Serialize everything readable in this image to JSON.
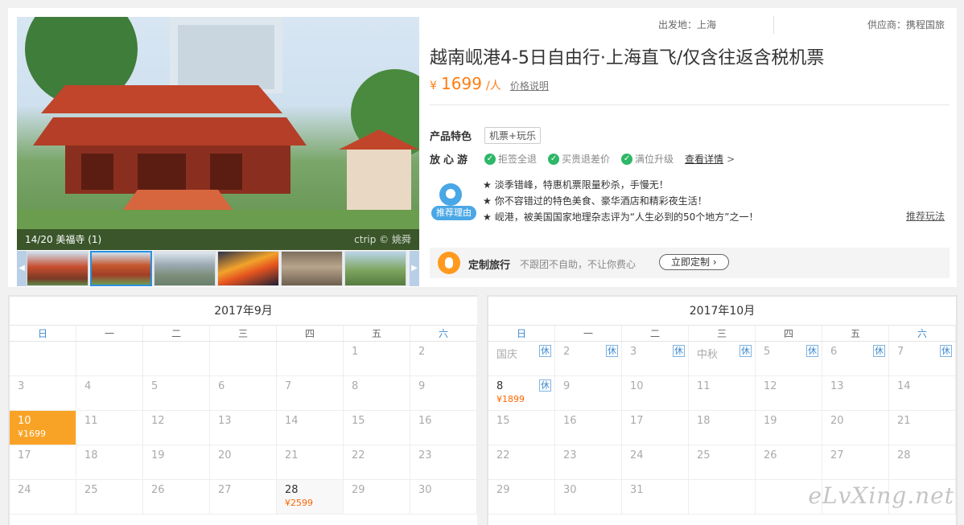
{
  "gallery": {
    "caption": "14/20 美福寺 (1)",
    "watermark": "ctrip © 姚舜",
    "prev": "◀",
    "next": "▶",
    "thumb_count": 6,
    "active_thumb": 2
  },
  "product": {
    "departure": "出发地：上海",
    "supplier": "供应商：携程国旅",
    "title": "越南岘港4-5日自由行·上海直飞/仅含往返含税机票",
    "price_symbol": "¥",
    "price": "1699",
    "price_unit": "/人",
    "price_note": "价格说明",
    "feature_label": "产品特色",
    "feature_tag": "机票+玩乐",
    "assure_label": "放心游",
    "assure_items": [
      "拒签全退",
      "买贵退差价",
      "满位升级"
    ],
    "assure_more": "查看详情",
    "assure_chevron": ">",
    "recommend_badge": "推荐理由",
    "recommend_lines": [
      "淡季错峰，特惠机票限量秒杀，手慢无！",
      "你不容错过的特色美食、豪华酒店和精彩夜生活！",
      "岘港，被美国国家地理杂志评为“人生必到的50个地方”之一！"
    ],
    "recommend_link": "推荐玩法",
    "custom_title": "定制旅行",
    "custom_desc": "不跟团不自助，不让你费心",
    "custom_button": "立即定制 ›"
  },
  "colors": {
    "accent": "#ff7d13",
    "selected": "#f9a326",
    "weekend": "#3c8ad0",
    "check": "#2eb766"
  },
  "calendar_sept": {
    "title": "2017年9月",
    "weekdays": [
      "日",
      "一",
      "二",
      "三",
      "四",
      "五",
      "六"
    ],
    "rows": [
      [
        {
          "d": ""
        },
        {
          "d": ""
        },
        {
          "d": ""
        },
        {
          "d": ""
        },
        {
          "d": ""
        },
        {
          "d": "1"
        },
        {
          "d": "2"
        }
      ],
      [
        {
          "d": "3"
        },
        {
          "d": "4"
        },
        {
          "d": "5"
        },
        {
          "d": "6"
        },
        {
          "d": "7"
        },
        {
          "d": "8"
        },
        {
          "d": "9"
        }
      ],
      [
        {
          "d": "10",
          "p": "¥1699",
          "sel": true
        },
        {
          "d": "11"
        },
        {
          "d": "12"
        },
        {
          "d": "13"
        },
        {
          "d": "14"
        },
        {
          "d": "15"
        },
        {
          "d": "16"
        }
      ],
      [
        {
          "d": "17"
        },
        {
          "d": "18"
        },
        {
          "d": "19"
        },
        {
          "d": "20"
        },
        {
          "d": "21"
        },
        {
          "d": "22"
        },
        {
          "d": "23"
        }
      ],
      [
        {
          "d": "24"
        },
        {
          "d": "25"
        },
        {
          "d": "26"
        },
        {
          "d": "27"
        },
        {
          "d": "28",
          "p": "¥2599",
          "hl": true
        },
        {
          "d": "29"
        },
        {
          "d": "30"
        }
      ]
    ]
  },
  "calendar_oct": {
    "title": "2017年10月",
    "weekdays": [
      "日",
      "一",
      "二",
      "三",
      "四",
      "五",
      "六"
    ],
    "rows": [
      [
        {
          "d": "国庆",
          "h": "休"
        },
        {
          "d": "2",
          "h": "休"
        },
        {
          "d": "3",
          "h": "休"
        },
        {
          "d": "中秋",
          "h": "休"
        },
        {
          "d": "5",
          "h": "休"
        },
        {
          "d": "6",
          "h": "休"
        },
        {
          "d": "7",
          "h": "休"
        }
      ],
      [
        {
          "d": "8",
          "p": "¥1899",
          "h": "休",
          "avail": true
        },
        {
          "d": "9"
        },
        {
          "d": "10"
        },
        {
          "d": "11"
        },
        {
          "d": "12"
        },
        {
          "d": "13"
        },
        {
          "d": "14"
        }
      ],
      [
        {
          "d": "15"
        },
        {
          "d": "16"
        },
        {
          "d": "17"
        },
        {
          "d": "18"
        },
        {
          "d": "19"
        },
        {
          "d": "20"
        },
        {
          "d": "21"
        }
      ],
      [
        {
          "d": "22"
        },
        {
          "d": "23"
        },
        {
          "d": "24"
        },
        {
          "d": "25"
        },
        {
          "d": "26"
        },
        {
          "d": "27"
        },
        {
          "d": "28"
        }
      ],
      [
        {
          "d": "29"
        },
        {
          "d": "30"
        },
        {
          "d": "31"
        },
        {
          "d": ""
        },
        {
          "d": ""
        },
        {
          "d": ""
        },
        {
          "d": ""
        }
      ]
    ]
  },
  "site_watermark": "eLvXing.net"
}
